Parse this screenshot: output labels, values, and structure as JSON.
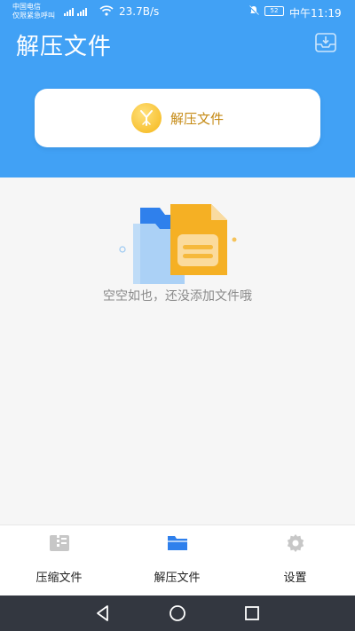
{
  "status": {
    "carrier_line1": "中国电信",
    "carrier_line2": "仅限紧急呼叫",
    "net_speed": "23.7B/s",
    "battery": "52",
    "time": "中午11:19"
  },
  "header": {
    "title": "解压文件",
    "action_icon": "inbox-download-icon"
  },
  "extract_card": {
    "label": "解压文件",
    "icon": "coin-icon"
  },
  "empty_state": {
    "text": "空空如也，还没添加文件哦"
  },
  "tabs": [
    {
      "label": "压缩文件",
      "icon": "archive-icon",
      "active": false
    },
    {
      "label": "解压文件",
      "icon": "folder-icon",
      "active": true
    },
    {
      "label": "设置",
      "icon": "gear-icon",
      "active": false
    }
  ],
  "colors": {
    "primary": "#41a1f5",
    "accent": "#f5b618",
    "inactive_icon": "#c7c7c7",
    "nav_bar": "#333740"
  }
}
